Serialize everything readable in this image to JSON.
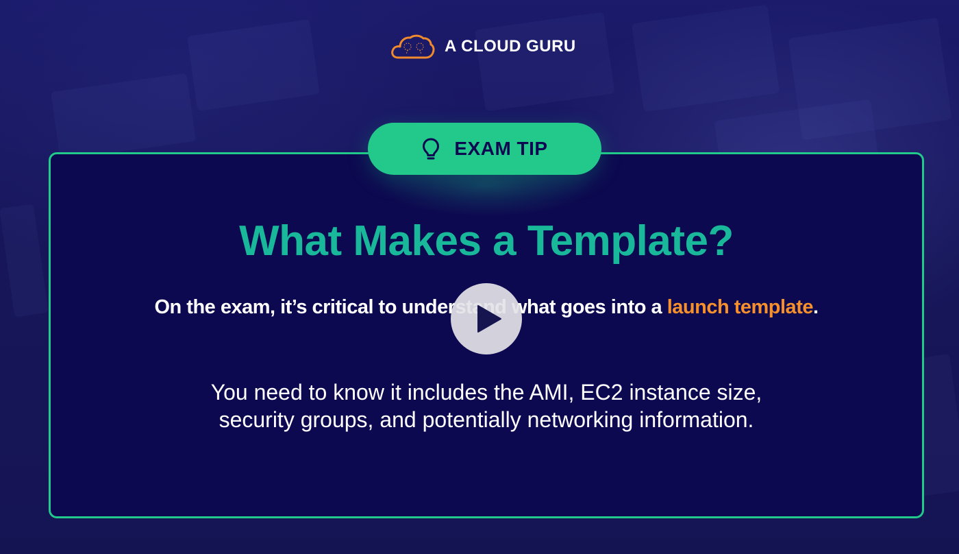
{
  "brand": {
    "name": "A CLOUD GURU",
    "logo_icon": "cloud-icon"
  },
  "badge": {
    "label": "EXAM TIP",
    "icon": "lightbulb-icon"
  },
  "content": {
    "title": "What Makes a Template?",
    "subtitle_prefix": "On the exam, it’s critical to understand what goes into a ",
    "subtitle_highlight": "launch template",
    "subtitle_suffix": ".",
    "body_line1": "You need to know it includes the AMI, EC2 instance size,",
    "body_line2": "security groups, and potentially networking information."
  },
  "player": {
    "control_icon": "play-icon"
  },
  "colors": {
    "background": "#1b1a6b",
    "card": "#0d0950",
    "accent_green": "#22c98a",
    "title_teal": "#19b89a",
    "highlight_orange": "#f5902d",
    "logo_orange": "#f08a2c"
  }
}
